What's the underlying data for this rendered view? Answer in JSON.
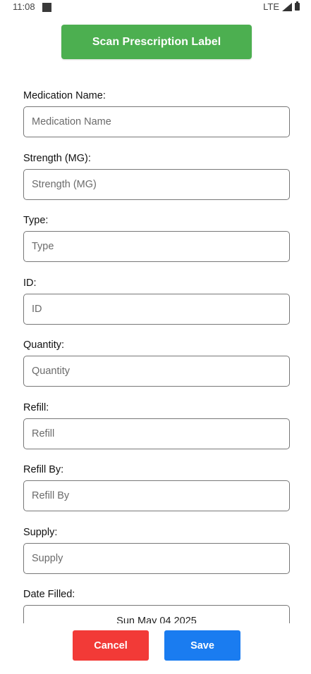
{
  "status_bar": {
    "time": "11:08",
    "network": "LTE"
  },
  "scan_button_label": "Scan Prescription Label",
  "fields": [
    {
      "label": "Medication Name:",
      "placeholder": "Medication Name",
      "value": ""
    },
    {
      "label": "Strength (MG):",
      "placeholder": "Strength (MG)",
      "value": ""
    },
    {
      "label": "Type:",
      "placeholder": "Type",
      "value": ""
    },
    {
      "label": "ID:",
      "placeholder": "ID",
      "value": ""
    },
    {
      "label": "Quantity:",
      "placeholder": "Quantity",
      "value": ""
    },
    {
      "label": "Refill:",
      "placeholder": "Refill",
      "value": ""
    },
    {
      "label": "Refill By:",
      "placeholder": "Refill By",
      "value": ""
    },
    {
      "label": "Supply:",
      "placeholder": "Supply",
      "value": ""
    }
  ],
  "date_filled": {
    "label": "Date Filled:",
    "value": "Sun May 04 2025"
  },
  "buttons": {
    "cancel": "Cancel",
    "save": "Save"
  },
  "colors": {
    "scan_button": "#4caf50",
    "cancel_button": "#f23a37",
    "save_button": "#1a7cf0"
  }
}
